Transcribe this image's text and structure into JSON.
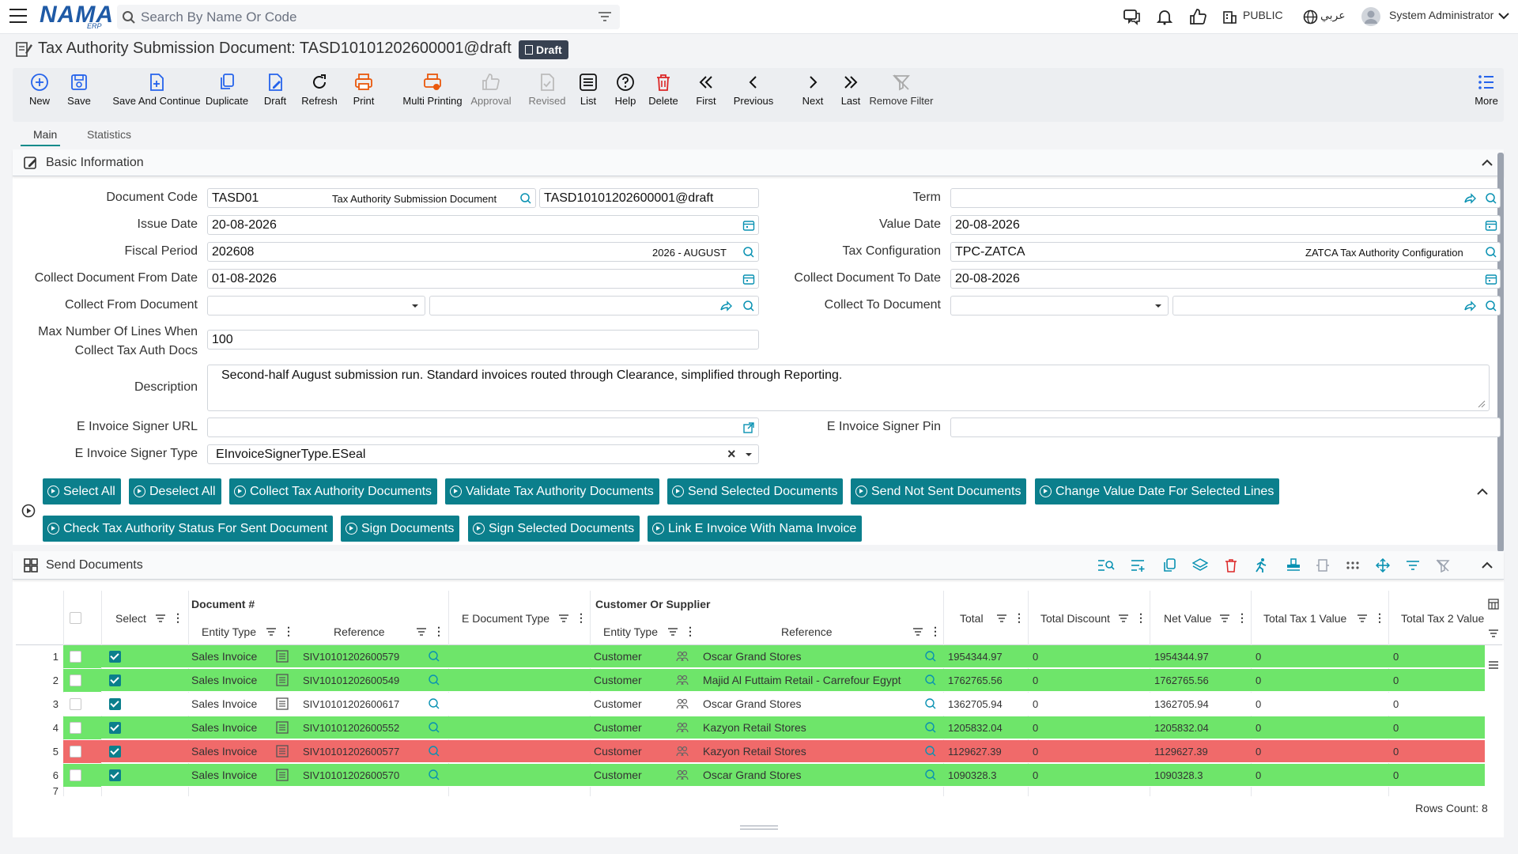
{
  "app": {
    "brand": "NAMA",
    "brand_sub": "ERP",
    "search_placeholder": "Search By Name Or Code",
    "public_label": "PUBLIC",
    "lang_label": "عربي",
    "user_name": "System Administrator"
  },
  "title": {
    "text": "Tax Authority Submission Document: TASD10101202600001@draft",
    "badge": "Draft"
  },
  "toolbar": [
    {
      "label": "New",
      "icon": "plus-circle-icon"
    },
    {
      "label": "Save",
      "icon": "save-icon"
    },
    {
      "label": "Save And Continue",
      "icon": "save-continue-icon"
    },
    {
      "label": "Duplicate",
      "icon": "duplicate-icon"
    },
    {
      "label": "Draft",
      "icon": "draft-icon"
    },
    {
      "label": "Refresh",
      "icon": "refresh-icon"
    },
    {
      "label": "Print",
      "icon": "print-icon"
    },
    {
      "label": "Multi Printing",
      "icon": "multi-print-icon"
    },
    {
      "label": "Approval",
      "icon": "thumbs-up-icon"
    },
    {
      "label": "Revised",
      "icon": "revised-icon"
    },
    {
      "label": "List",
      "icon": "list-icon"
    },
    {
      "label": "Help",
      "icon": "help-icon"
    },
    {
      "label": "Delete",
      "icon": "trash-icon"
    },
    {
      "label": "First",
      "icon": "first-icon"
    },
    {
      "label": "Previous",
      "icon": "previous-icon"
    },
    {
      "label": "Next",
      "icon": "next-icon"
    },
    {
      "label": "Last",
      "icon": "last-icon"
    },
    {
      "label": "Remove Filter",
      "icon": "remove-filter-icon"
    },
    {
      "label": "More",
      "icon": "more-icon"
    }
  ],
  "tabs": {
    "main": "Main",
    "statistics": "Statistics"
  },
  "basic": {
    "header": "Basic Information",
    "document_code_label": "Document Code",
    "document_code": "TASD01",
    "document_code_name": "Tax Authority Submission Document",
    "document_number": "TASD10101202600001@draft",
    "term_label": "Term",
    "term": "",
    "issue_date_label": "Issue Date",
    "issue_date": "20-08-2026",
    "value_date_label": "Value Date",
    "value_date": "20-08-2026",
    "fiscal_period_label": "Fiscal Period",
    "fiscal_period": "202608",
    "fiscal_period_name": "2026 - AUGUST",
    "tax_config_label": "Tax Configuration",
    "tax_config": "TPC-ZATCA",
    "tax_config_name": "ZATCA Tax Authority Configuration",
    "collect_from_date_label": "Collect Document From Date",
    "collect_from_date": "01-08-2026",
    "collect_to_date_label": "Collect Document To Date",
    "collect_to_date": "20-08-2026",
    "collect_from_doc_label": "Collect From Document",
    "collect_to_doc_label": "Collect To Document",
    "max_lines_label_1": "Max Number Of Lines When",
    "max_lines_label_2": "Collect Tax Auth Docs",
    "max_lines": "100",
    "description_label": "Description",
    "description": "Second-half August submission run. Standard invoices routed through Clearance, simplified through Reporting.",
    "signer_url_label": "E Invoice Signer URL",
    "signer_url": "",
    "signer_pin_label": "E Invoice Signer Pin",
    "signer_pin": "",
    "signer_type_label": "E Invoice Signer Type",
    "signer_type": "EInvoiceSignerType.ESeal"
  },
  "actions": [
    "Select All",
    "Deselect All",
    "Collect Tax Authority Documents",
    "Validate Tax Authority Documents",
    "Send Selected Documents",
    "Send Not Sent Documents",
    "Change Value Date For Selected Lines",
    "Check Tax Authority Status For Sent Document",
    "Sign Documents",
    "Sign Selected Documents",
    "Link E Invoice With Nama Invoice"
  ],
  "send_docs": {
    "header": "Send Documents",
    "columns": {
      "select": "Select",
      "document": "Document #",
      "entity_type": "Entity Type",
      "reference": "Reference",
      "edoc_type": "E Document Type",
      "customer": "Customer Or Supplier",
      "total": "Total",
      "total_discount": "Total Discount",
      "net_value": "Net Value",
      "tax1": "Total Tax 1 Value",
      "tax2": "Total Tax 2 Value"
    },
    "rows": [
      {
        "n": "1",
        "status": "ok",
        "selected": true,
        "entity": "Sales Invoice",
        "ref": "SIV10101202600579",
        "cust_type": "Customer",
        "cust": "Oscar Grand Stores",
        "total": "1954344.97",
        "discount": "0",
        "net": "1954344.97",
        "tax1": "0",
        "tax2": "0"
      },
      {
        "n": "2",
        "status": "ok",
        "selected": true,
        "entity": "Sales Invoice",
        "ref": "SIV10101202600549",
        "cust_type": "Customer",
        "cust": "Majid Al Futtaim Retail - Carrefour Egypt",
        "total": "1762765.56",
        "discount": "0",
        "net": "1762765.56",
        "tax1": "0",
        "tax2": "0"
      },
      {
        "n": "3",
        "status": "none",
        "selected": true,
        "entity": "Sales Invoice",
        "ref": "SIV10101202600617",
        "cust_type": "Customer",
        "cust": "Oscar Grand Stores",
        "total": "1362705.94",
        "discount": "0",
        "net": "1362705.94",
        "tax1": "0",
        "tax2": "0"
      },
      {
        "n": "4",
        "status": "ok",
        "selected": true,
        "entity": "Sales Invoice",
        "ref": "SIV10101202600552",
        "cust_type": "Customer",
        "cust": "Kazyon Retail Stores",
        "total": "1205832.04",
        "discount": "0",
        "net": "1205832.04",
        "tax1": "0",
        "tax2": "0"
      },
      {
        "n": "5",
        "status": "error",
        "selected": true,
        "entity": "Sales Invoice",
        "ref": "SIV10101202600577",
        "cust_type": "Customer",
        "cust": "Kazyon Retail Stores",
        "total": "1129627.39",
        "discount": "0",
        "net": "1129627.39",
        "tax1": "0",
        "tax2": "0"
      },
      {
        "n": "6",
        "status": "ok",
        "selected": true,
        "entity": "Sales Invoice",
        "ref": "SIV10101202600570",
        "cust_type": "Customer",
        "cust": "Oscar Grand Stores",
        "total": "1090328.3",
        "discount": "0",
        "net": "1090328.3",
        "tax1": "0",
        "tax2": "0"
      }
    ],
    "rows_count": "Rows Count: 8"
  },
  "colors": {
    "accent": "#0b7f8c",
    "ok_row": "#6ee56a",
    "error_row": "#f06a6a",
    "brand": "#1f5aa6"
  }
}
